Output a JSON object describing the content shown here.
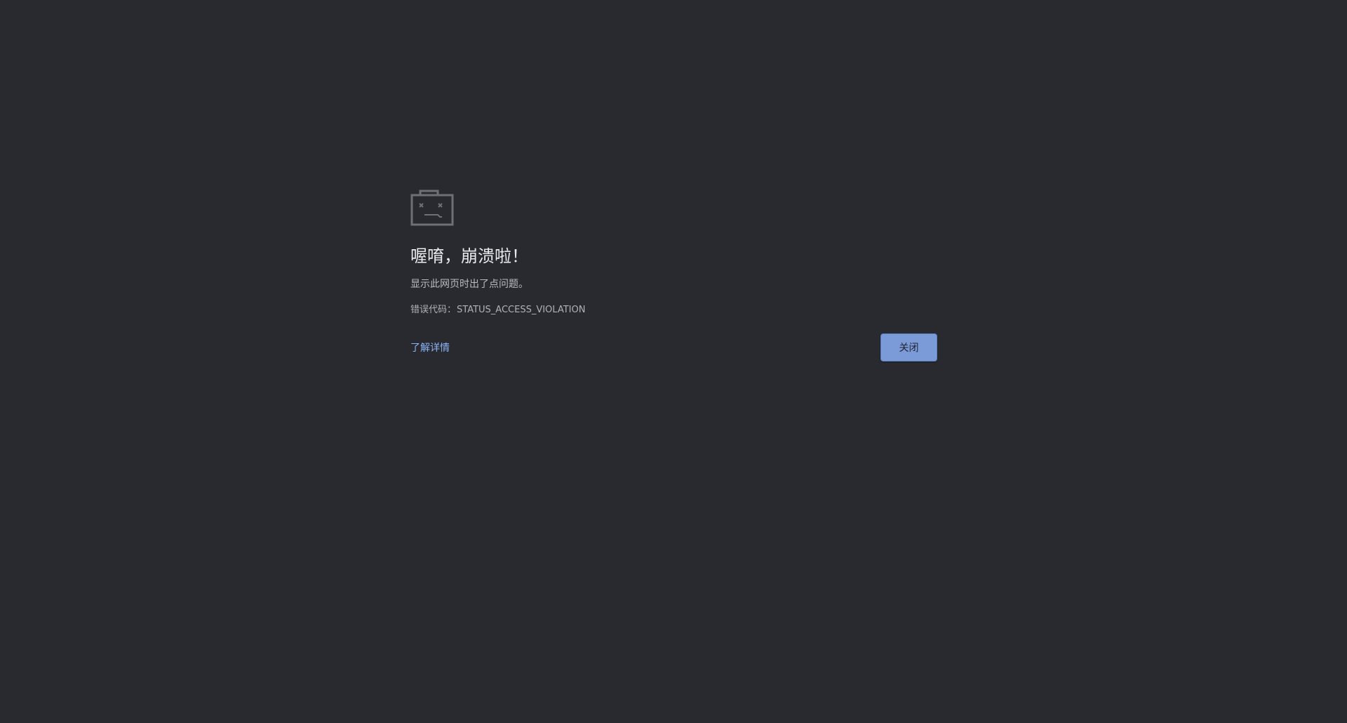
{
  "error_page": {
    "title": "喔唷，崩溃啦！",
    "description": "显示此网页时出了点问题。",
    "error_code_label": "错误代码：",
    "error_code": "STATUS_ACCESS_VIOLATION",
    "learn_more_label": "了解详情",
    "close_label": "关闭",
    "icon": "sad-folder-icon"
  },
  "colors": {
    "background": "#292a2f",
    "title": "#e8eaed",
    "description": "#b8bcc2",
    "link": "#8ab4f8",
    "button": "#7b9ad8",
    "icon": "#6f7074"
  }
}
